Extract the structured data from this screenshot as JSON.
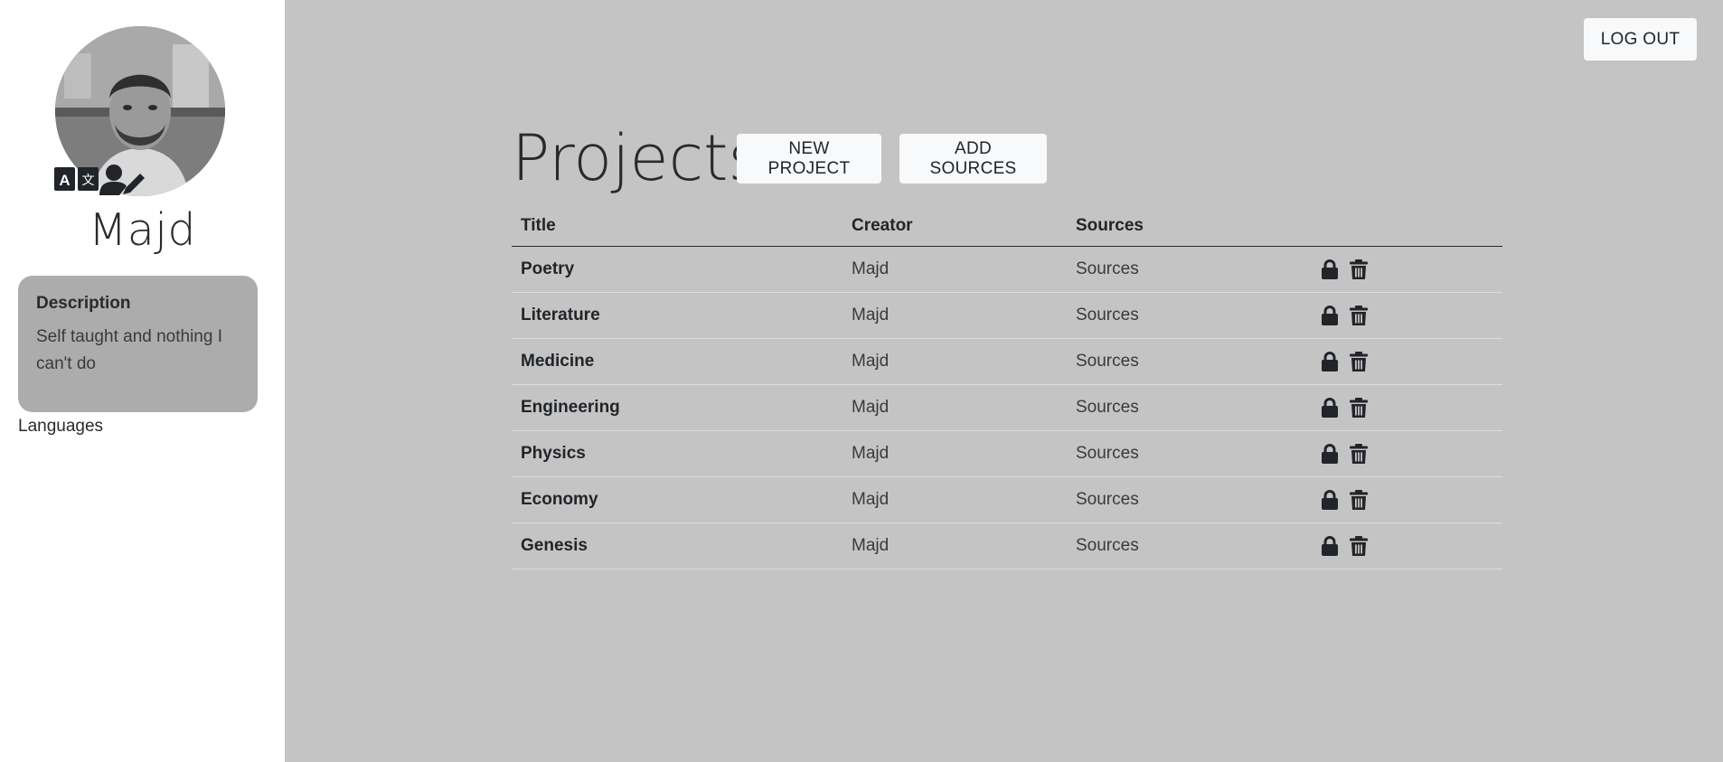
{
  "profile": {
    "name": "Majd",
    "description_title": "Description",
    "description_text": "Self taught and nothing I can't do",
    "languages_label": "Languages",
    "icons": [
      "translate-icon",
      "user-edit-icon"
    ]
  },
  "header": {
    "logout_label": "LOG OUT",
    "page_title": "Projects",
    "new_project_label": "NEW PROJECT",
    "add_sources_label": "ADD SOURCES"
  },
  "table": {
    "columns": [
      "Title",
      "Creator",
      "Sources",
      ""
    ],
    "rows": [
      {
        "title": "Poetry",
        "creator": "Majd",
        "sources": "Sources"
      },
      {
        "title": "Literature",
        "creator": "Majd",
        "sources": "Sources"
      },
      {
        "title": "Medicine",
        "creator": "Majd",
        "sources": "Sources"
      },
      {
        "title": "Engineering",
        "creator": "Majd",
        "sources": "Sources"
      },
      {
        "title": "Physics",
        "creator": "Majd",
        "sources": "Sources"
      },
      {
        "title": "Economy",
        "creator": "Majd",
        "sources": "Sources"
      },
      {
        "title": "Genesis",
        "creator": "Majd",
        "sources": "Sources"
      }
    ],
    "row_icons": [
      "lock-icon",
      "trash-icon"
    ]
  },
  "colors": {
    "main_bg": "#c4c4c4",
    "sidebar_bg": "#ffffff",
    "card_bg": "#acacac",
    "button_bg": "#f8f9fa",
    "text": "#212529"
  }
}
